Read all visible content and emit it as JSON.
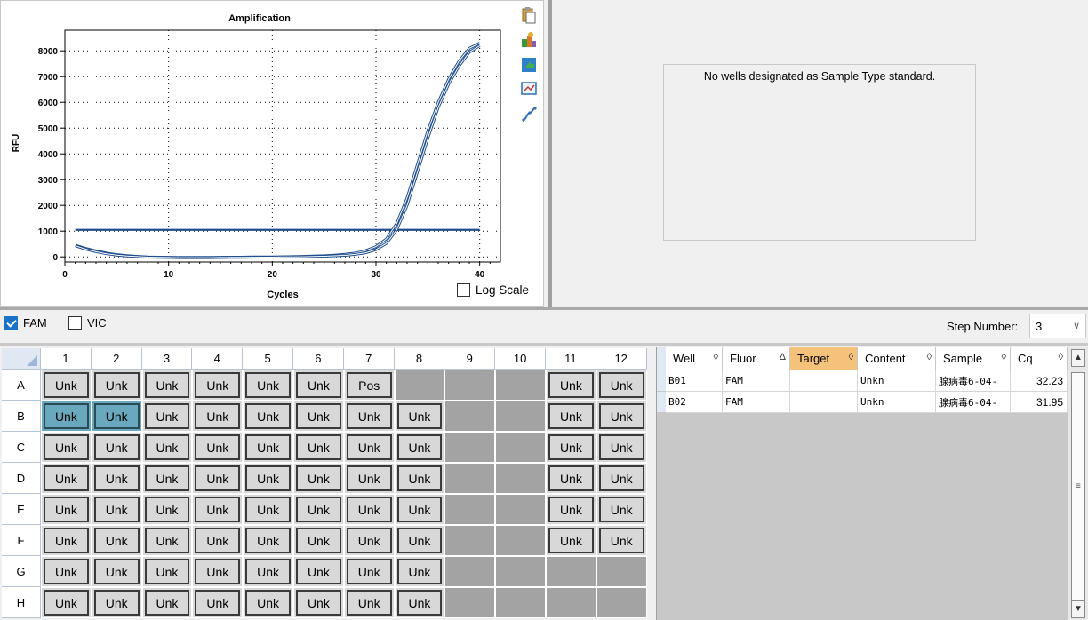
{
  "chart": {
    "title": "Amplification",
    "xlabel": "Cycles",
    "ylabel": "RFU",
    "log_scale_label": "Log Scale",
    "log_scale_checked": false,
    "threshold_color": "#1f4e8c",
    "curve_color": "#3d6fb0"
  },
  "chart_data": {
    "type": "line",
    "title": "Amplification",
    "xlabel": "Cycles",
    "ylabel": "RFU",
    "xlim": [
      0,
      42
    ],
    "ylim": [
      -200,
      8800
    ],
    "x_ticks": [
      0,
      10,
      20,
      30,
      40
    ],
    "y_ticks": [
      0,
      1000,
      2000,
      3000,
      4000,
      5000,
      6000,
      7000,
      8000
    ],
    "grid": true,
    "threshold": 1050,
    "series": [
      {
        "x": [
          1,
          2,
          3,
          4,
          5,
          6,
          7,
          8,
          9,
          10,
          11,
          12,
          13,
          14,
          15,
          16,
          17,
          18,
          19,
          20,
          21,
          22,
          23,
          24,
          25,
          26,
          27,
          28,
          29,
          30,
          31,
          32,
          33,
          34,
          35,
          36,
          37,
          38,
          39,
          40
        ],
        "values": [
          450,
          330,
          230,
          150,
          90,
          50,
          20,
          0,
          -10,
          -15,
          -20,
          -20,
          -20,
          -20,
          -15,
          -10,
          -10,
          -5,
          0,
          0,
          5,
          10,
          20,
          30,
          45,
          70,
          100,
          150,
          240,
          400,
          700,
          1300,
          2300,
          3600,
          4900,
          6000,
          6900,
          7600,
          8100,
          8300
        ]
      },
      {
        "x": [
          1,
          2,
          3,
          4,
          5,
          6,
          7,
          8,
          9,
          10,
          11,
          12,
          13,
          14,
          15,
          16,
          17,
          18,
          19,
          20,
          21,
          22,
          23,
          24,
          25,
          26,
          27,
          28,
          29,
          30,
          31,
          32,
          33,
          34,
          35,
          36,
          37,
          38,
          39,
          40
        ],
        "values": [
          430,
          300,
          200,
          120,
          70,
          30,
          10,
          -10,
          -20,
          -25,
          -30,
          -30,
          -30,
          -30,
          -25,
          -20,
          -20,
          -15,
          -10,
          -10,
          -5,
          0,
          5,
          15,
          25,
          40,
          60,
          95,
          160,
          280,
          520,
          1050,
          2000,
          3300,
          4600,
          5800,
          6700,
          7400,
          7950,
          8200
        ]
      }
    ]
  },
  "toolbar_icons": [
    "clipboard-icon",
    "export-icon",
    "save-image-icon",
    "chart-settings-icon",
    "curve-fit-icon"
  ],
  "std_curve": {
    "message": "No wells designated as Sample Type standard."
  },
  "fluors": [
    {
      "label": "FAM",
      "checked": true
    },
    {
      "label": "VIC",
      "checked": false
    }
  ],
  "step": {
    "label": "Step Number:",
    "value": "3"
  },
  "plate": {
    "columns": [
      "1",
      "2",
      "3",
      "4",
      "5",
      "6",
      "7",
      "8",
      "9",
      "10",
      "11",
      "12"
    ],
    "rows": [
      "A",
      "B",
      "C",
      "D",
      "E",
      "F",
      "G",
      "H"
    ],
    "wells": [
      [
        "Unk",
        "Unk",
        "Unk",
        "Unk",
        "Unk",
        "Unk",
        "Pos",
        "",
        "",
        "",
        "Unk",
        "Unk"
      ],
      [
        "Unk",
        "Unk",
        "Unk",
        "Unk",
        "Unk",
        "Unk",
        "Unk",
        "Unk",
        "",
        "",
        "Unk",
        "Unk"
      ],
      [
        "Unk",
        "Unk",
        "Unk",
        "Unk",
        "Unk",
        "Unk",
        "Unk",
        "Unk",
        "",
        "",
        "Unk",
        "Unk"
      ],
      [
        "Unk",
        "Unk",
        "Unk",
        "Unk",
        "Unk",
        "Unk",
        "Unk",
        "Unk",
        "",
        "",
        "Unk",
        "Unk"
      ],
      [
        "Unk",
        "Unk",
        "Unk",
        "Unk",
        "Unk",
        "Unk",
        "Unk",
        "Unk",
        "",
        "",
        "Unk",
        "Unk"
      ],
      [
        "Unk",
        "Unk",
        "Unk",
        "Unk",
        "Unk",
        "Unk",
        "Unk",
        "Unk",
        "",
        "",
        "Unk",
        "Unk"
      ],
      [
        "Unk",
        "Unk",
        "Unk",
        "Unk",
        "Unk",
        "Unk",
        "Unk",
        "Unk",
        "",
        "",
        "",
        ""
      ],
      [
        "Unk",
        "Unk",
        "Unk",
        "Unk",
        "Unk",
        "Unk",
        "Unk",
        "Unk",
        "",
        "",
        "",
        ""
      ]
    ],
    "selected": [
      "B1",
      "B2"
    ]
  },
  "results": {
    "headers": [
      {
        "label": "Well",
        "sort": "◊"
      },
      {
        "label": "Fluor",
        "sort": "Δ"
      },
      {
        "label": "Target",
        "sort": "◊"
      },
      {
        "label": "Content",
        "sort": "◊"
      },
      {
        "label": "Sample",
        "sort": "◊"
      },
      {
        "label": "Cq",
        "sort": "◊"
      }
    ],
    "rows": [
      [
        "B01",
        "FAM",
        "",
        "Unkn",
        "腺病毒6-04-",
        "32.23"
      ],
      [
        "B02",
        "FAM",
        "",
        "Unkn",
        "腺病毒6-04-",
        "31.95"
      ]
    ]
  }
}
